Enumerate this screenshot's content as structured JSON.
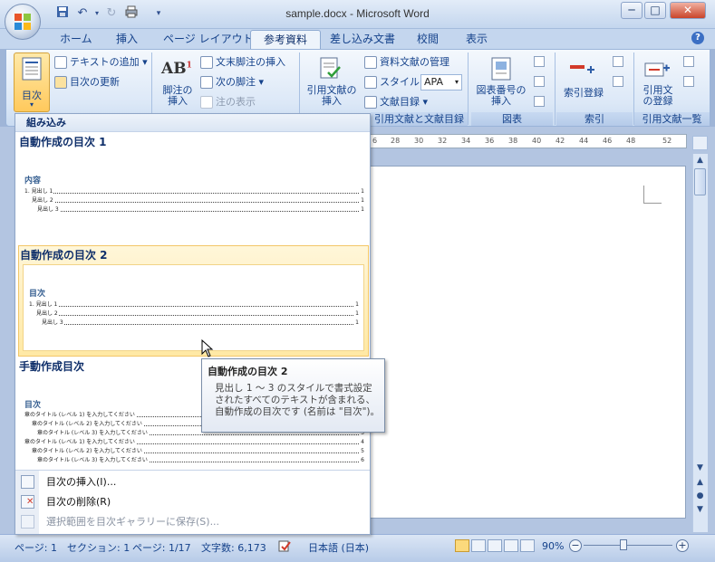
{
  "window": {
    "title": "sample.docx - Microsoft Word",
    "minimize": "─",
    "maximize": "□",
    "close": "✕"
  },
  "tabs": [
    {
      "label": "ホーム"
    },
    {
      "label": "挿入"
    },
    {
      "label": "ページ レイアウト"
    },
    {
      "label": "参考資料",
      "active": true
    },
    {
      "label": "差し込み文書"
    },
    {
      "label": "校閲"
    },
    {
      "label": "表示"
    }
  ],
  "ribbon": {
    "toc_group": {
      "toc_button": "目次",
      "add_text": "テキストの追加",
      "update_toc": "目次の更新"
    },
    "footnote_group": {
      "insert_footnote": "脚注の\n挿入",
      "insert_endnote": "文末脚注の挿入",
      "next_footnote": "次の脚注",
      "show_notes": "注の表示"
    },
    "citations_group": {
      "insert_citation": "引用文献の\n挿入",
      "manage_sources": "資料文献の管理",
      "style_label": "スタイル:",
      "style_value": "APA",
      "bibliography": "文献目録",
      "label": "引用文献と文献目録"
    },
    "captions_group": {
      "insert_caption": "図表番号の\n挿入",
      "label": "図表"
    },
    "index_group": {
      "mark_entry": "索引登録",
      "label": "索引"
    },
    "toa_group": {
      "mark_citation": "引用文\nの登録",
      "label": "引用文献一覧"
    }
  },
  "ruler": {
    "ticks": [
      "6",
      "28",
      "30",
      "32",
      "34",
      "36",
      "38",
      "40",
      "42",
      "44",
      "46",
      "48",
      "52"
    ]
  },
  "gallery": {
    "header": "組み込み",
    "items": [
      {
        "title": "自動作成の目次 1",
        "heading": "内容",
        "lines": [
          {
            "label": "1.   見出し 1",
            "page": "1"
          },
          {
            "label": "見出し 2",
            "page": "1"
          },
          {
            "label": "見出し 3",
            "page": "1"
          }
        ]
      },
      {
        "title": "自動作成の目次 2",
        "heading": "目次",
        "lines": [
          {
            "label": "1.   見出し 1",
            "page": "1"
          },
          {
            "label": "見出し 2",
            "page": "1"
          },
          {
            "label": "見出し 3",
            "page": "1"
          }
        ]
      },
      {
        "title": "手動作成目次",
        "heading": "目次",
        "lines": [
          {
            "label": "章のタイトル (レベル 1) を入力してください",
            "page": "1"
          },
          {
            "label": "章のタイトル (レベル 2) を入力してください",
            "page": "2"
          },
          {
            "label": "章のタイトル (レベル 3) を入力してください",
            "page": "3"
          },
          {
            "label": "章のタイトル (レベル 1) を入力してください",
            "page": "4"
          },
          {
            "label": "章のタイトル (レベル 2) を入力してください",
            "page": "5"
          },
          {
            "label": "章のタイトル (レベル 3) を入力してください",
            "page": "6"
          }
        ]
      }
    ],
    "menu": {
      "insert_toc": "目次の挿入(I)...",
      "remove_toc": "目次の削除(R)",
      "save_selection": "選択範囲を目次ギャラリーに保存(S)..."
    }
  },
  "tooltip": {
    "title": "自動作成の目次 2",
    "body": "見出し 1 ～ 3 のスタイルで書式設定されたすべてのテキストが含まれる、自動作成の目次です (名前は \"目次\")。"
  },
  "statusbar": {
    "page": "ページ: 1",
    "section": "セクション: 1",
    "pages": "ページ: 1/17",
    "word_count": "文字数: 6,173",
    "language": "日本語 (日本)",
    "zoom": "90%"
  }
}
